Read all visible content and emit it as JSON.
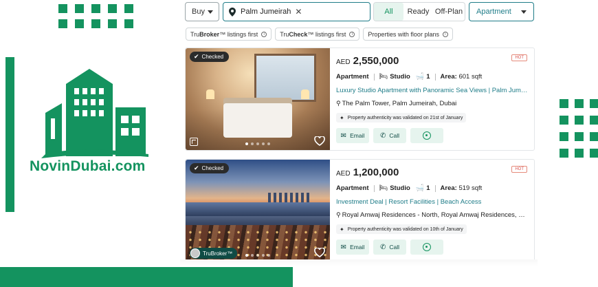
{
  "brand": {
    "logo_text": "NovinDubai.com",
    "accent_color": "#14935f",
    "link_color": "#1e7c88"
  },
  "search": {
    "purpose_select": "Buy",
    "location_chip": "Palm Jumeirah",
    "completion_tabs": [
      "All",
      "Ready",
      "Off-Plan"
    ],
    "active_completion": "All",
    "property_type_select": "Apartment"
  },
  "filters": {
    "chips": [
      {
        "prefix": "Tru",
        "bold": "Broker",
        "suffix": "™ listings first"
      },
      {
        "prefix": "Tru",
        "bold": "Check",
        "suffix": "™ listings first"
      },
      {
        "prefix": "Properties with floor plans",
        "bold": "",
        "suffix": ""
      }
    ]
  },
  "listings": [
    {
      "checked_badge": "Checked",
      "currency": "AED",
      "price": "2,550,000",
      "hot_badge": "HOT",
      "type": "Apartment",
      "bedrooms": "Studio",
      "bathrooms": "1",
      "area_label": "Area:",
      "area": "601 sqft",
      "title": "Luxury Studio Apartment with Panoramic Sea Views | Palm Jumeirah | ...",
      "location": "The Palm Tower, Palm Jumeirah, Dubai",
      "authenticity": "Property authenticity was validated on 21st of January",
      "email_label": "Email",
      "call_label": "Call"
    },
    {
      "checked_badge": "Checked",
      "currency": "AED",
      "price": "1,200,000",
      "hot_badge": "HOT",
      "type": "Apartment",
      "bedrooms": "Studio",
      "bathrooms": "1",
      "area_label": "Area:",
      "area": "519 sqft",
      "title": "Investment Deal | Resort Facilities | Beach Access",
      "location": "Royal Amwaj Residences - North, Royal Amwaj Residences, Palm Jum...",
      "authenticity": "Property authenticity was validated on 10th of January",
      "email_label": "Email",
      "call_label": "Call",
      "broker_badge": "TruBroker™"
    }
  ]
}
